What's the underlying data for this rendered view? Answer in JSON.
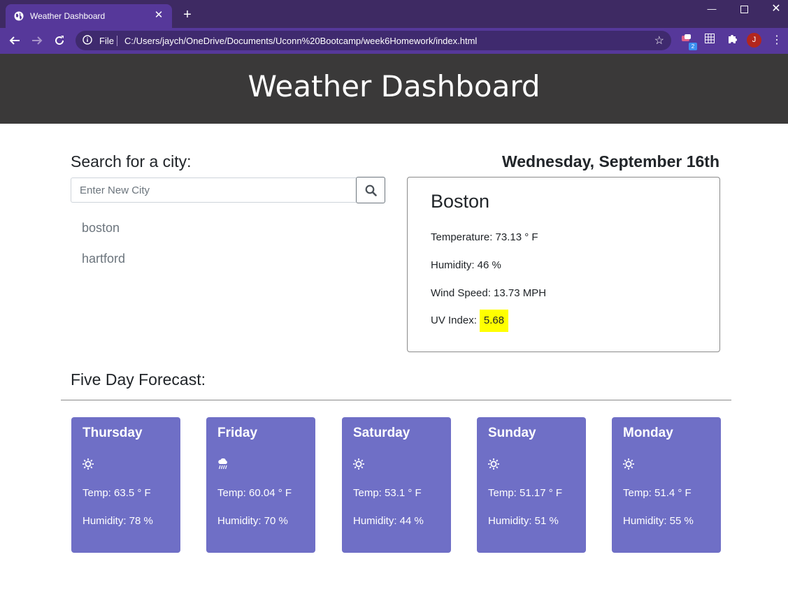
{
  "browser": {
    "tab_title": "Weather Dashboard",
    "address_scheme": "File",
    "address_url": "C:/Users/jaych/OneDrive/Documents/Uconn%20Bootcamp/week6Homework/index.html",
    "extension_badge": "2",
    "profile_initial": "J"
  },
  "header": {
    "title": "Weather Dashboard"
  },
  "search": {
    "label": "Search for a city:",
    "placeholder": "Enter New City",
    "value": "",
    "history": [
      "boston",
      "hartford"
    ]
  },
  "current": {
    "date": "Wednesday, September 16th",
    "city": "Boston",
    "temperature": "Temperature: 73.13 ° F",
    "humidity": "Humidity: 46 %",
    "wind": "Wind Speed: 13.73 MPH",
    "uv_label": "UV Index:",
    "uv_value": "5.68",
    "uv_color": "#ffff00"
  },
  "forecast": {
    "title": "Five Day Forecast:",
    "card_color": "#6f6fc6",
    "days": [
      {
        "day": "Thursday",
        "icon": "sun-icon",
        "temp": "Temp: 63.5 ° F",
        "humidity": "Humidity: 78 %"
      },
      {
        "day": "Friday",
        "icon": "rain-icon",
        "temp": "Temp: 60.04 ° F",
        "humidity": "Humidity: 70 %"
      },
      {
        "day": "Saturday",
        "icon": "sun-icon",
        "temp": "Temp: 53.1 ° F",
        "humidity": "Humidity: 44 %"
      },
      {
        "day": "Sunday",
        "icon": "sun-icon",
        "temp": "Temp: 51.17 ° F",
        "humidity": "Humidity: 51 %"
      },
      {
        "day": "Monday",
        "icon": "sun-icon",
        "temp": "Temp: 51.4 ° F",
        "humidity": "Humidity: 55 %"
      }
    ]
  }
}
